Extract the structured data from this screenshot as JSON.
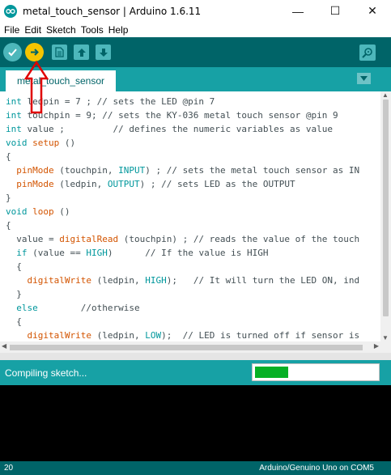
{
  "window": {
    "title": "metal_touch_sensor | Arduino 1.6.11",
    "minimize": "—",
    "maximize": "☐",
    "close": "✕"
  },
  "menu": [
    {
      "label": "File"
    },
    {
      "label": "Edit"
    },
    {
      "label": "Sketch"
    },
    {
      "label": "Tools"
    },
    {
      "label": "Help"
    }
  ],
  "toolbar": {
    "verify_icon": "check-icon",
    "upload_icon": "arrow-right-icon",
    "new_icon": "new-file-icon",
    "open_icon": "arrow-up-icon",
    "save_icon": "arrow-down-icon",
    "serial_monitor_icon": "magnifier-icon"
  },
  "tab": {
    "label": "metal_touch_sensor"
  },
  "code_lines": [
    "int ledpin = 7 ; // sets the LED @pin 7",
    "int touchpin = 9; // sets the KY-036 metal touch sensor @pin 9",
    "int value ;         // defines the numeric variables as value",
    "void setup ()",
    "{",
    "  pinMode (touchpin, INPUT) ; // sets the metal touch sensor as IN",
    "  pinMode (ledpin, OUTPUT) ; // sets LED as the OUTPUT",
    "}",
    "void loop ()",
    "{",
    "  value = digitalRead (touchpin) ; // reads the value of the touch",
    "  if (value == HIGH)      // If the value is HIGH",
    "  {",
    "    digitalWrite (ledpin, HIGH);   // It will turn the LED ON, ind",
    "  }",
    "  else        //otherwise",
    "  {",
    "    digitalWrite (ledpin, LOW);  // LED is turned off if sensor is"
  ],
  "status": {
    "message": "Compiling sketch...",
    "progress": 0.27
  },
  "footer": {
    "line": "20",
    "board": "Arduino/Genuino Uno on COM5"
  },
  "colors": {
    "toolbar": "#006468",
    "tabbar": "#17a1a5",
    "run_button": "#f5c400",
    "progress": "#06b025",
    "annotation": "#e00000"
  }
}
